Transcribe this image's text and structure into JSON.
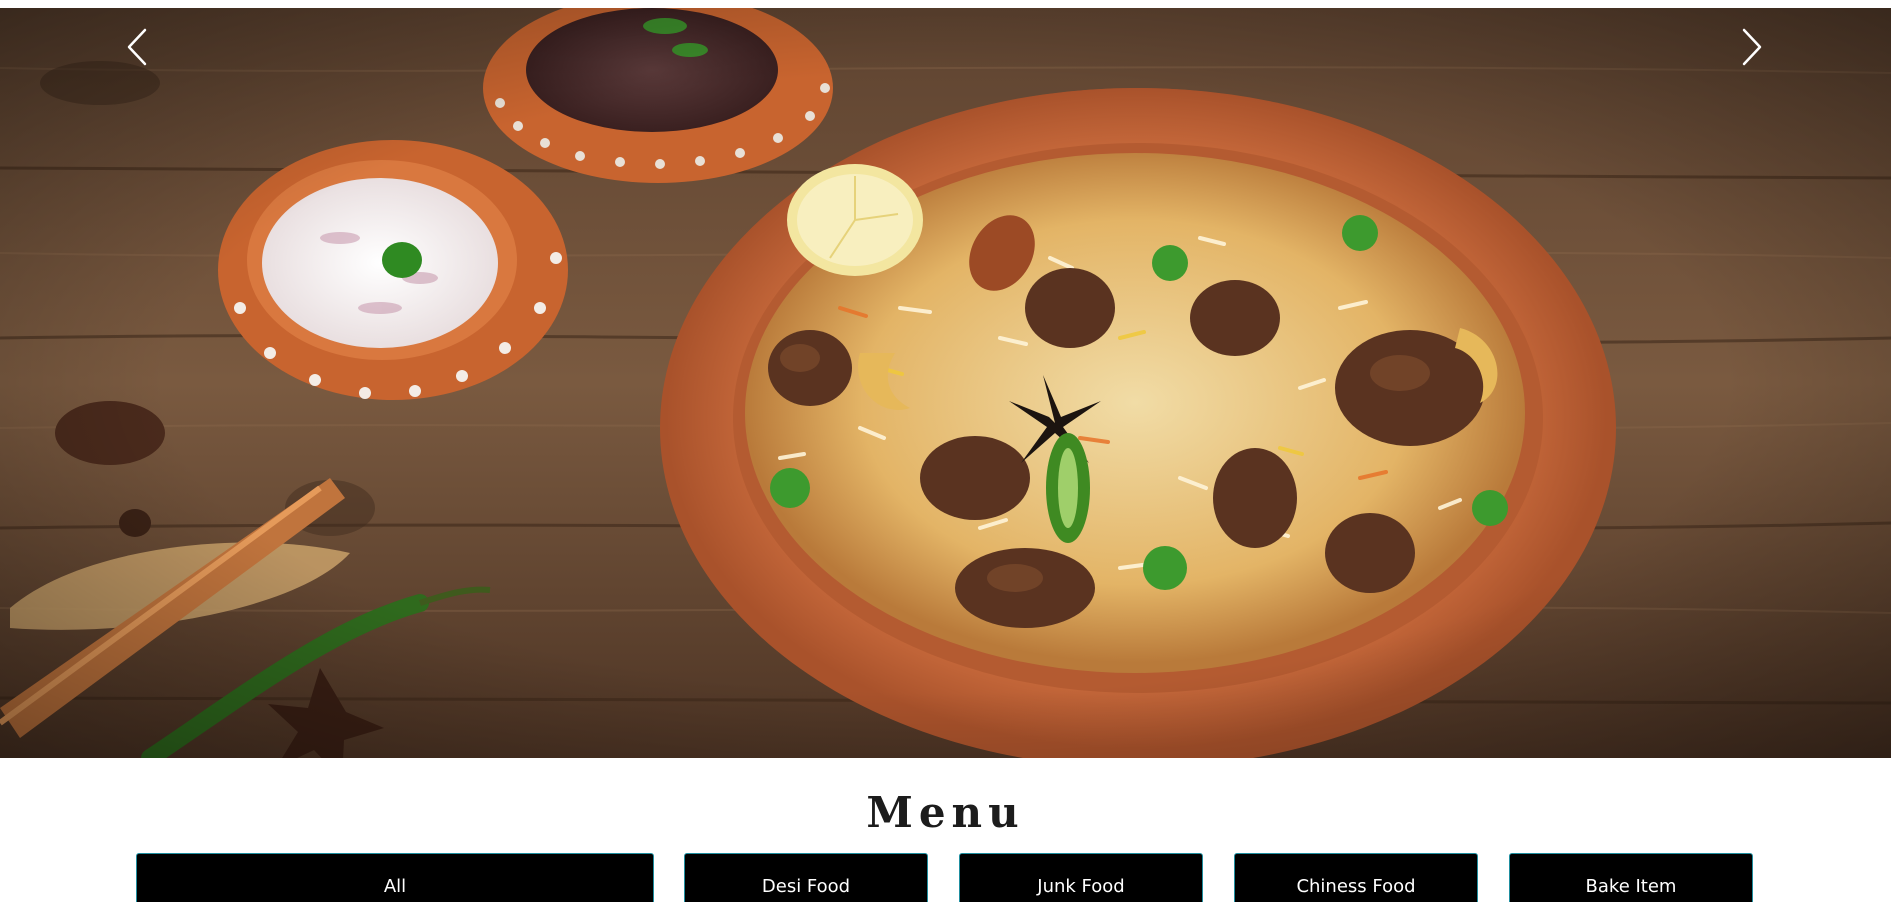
{
  "hero": {
    "prev_icon": "chevron-left-icon",
    "next_icon": "chevron-right-icon"
  },
  "menu": {
    "title": "Menu",
    "tabs": [
      {
        "label": "All"
      },
      {
        "label": "Desi Food"
      },
      {
        "label": "Junk Food"
      },
      {
        "label": "Chiness Food"
      },
      {
        "label": "Bake Item"
      }
    ]
  },
  "colors": {
    "tab_background": "#000000",
    "tab_text": "#ffffff",
    "tab_border": "#1f8fa0",
    "title_text": "#1c1c1c"
  }
}
